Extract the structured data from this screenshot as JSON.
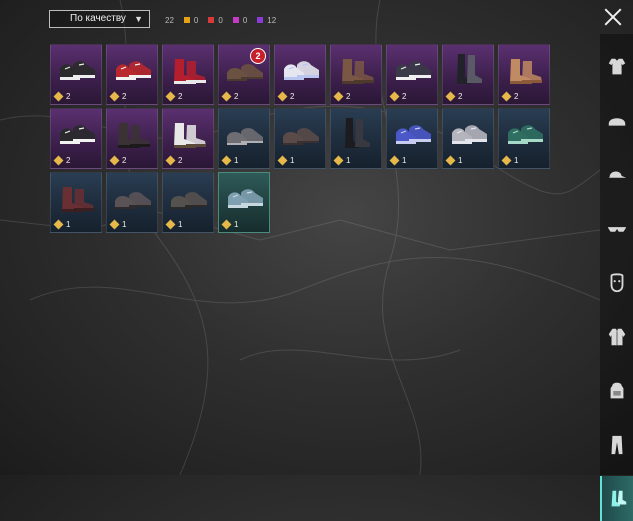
{
  "sort": {
    "label": "По качеству"
  },
  "summary": {
    "total": "22",
    "gold": {
      "count": "0",
      "color": "#e3a21a"
    },
    "red": {
      "count": "0",
      "color": "#d73a3a"
    },
    "pink": {
      "count": "0",
      "color": "#c43cc4"
    },
    "purple": {
      "count": "12",
      "color": "#8a3bd8"
    }
  },
  "categories": [
    {
      "name": "top-icon"
    },
    {
      "name": "helmet-icon"
    },
    {
      "name": "hat-icon"
    },
    {
      "name": "glasses-icon"
    },
    {
      "name": "mask-icon"
    },
    {
      "name": "jacket-icon"
    },
    {
      "name": "backpack-icon"
    },
    {
      "name": "pants-icon"
    },
    {
      "name": "shoes-icon",
      "active": true
    }
  ],
  "items": [
    {
      "count": "2",
      "rarity": "purple",
      "color": "#2b2b2b",
      "accent": "#eeeeee",
      "type": "sneaker"
    },
    {
      "count": "2",
      "rarity": "purple",
      "color": "#b8282c",
      "accent": "#f2f2f2",
      "type": "sneaker"
    },
    {
      "count": "2",
      "rarity": "purple",
      "color": "#b51f2d",
      "accent": "#e8e8e8",
      "type": "boot"
    },
    {
      "count": "2",
      "rarity": "purple",
      "color": "#6b5142",
      "accent": "#4a3a30",
      "type": "shoe",
      "badge": "2"
    },
    {
      "count": "2",
      "rarity": "purple",
      "color": "#e6e6f0",
      "accent": "#b9c6f0",
      "type": "sneaker"
    },
    {
      "count": "2",
      "rarity": "purple",
      "color": "#7a5744",
      "accent": "#4e3a2d",
      "type": "boot"
    },
    {
      "count": "2",
      "rarity": "purple",
      "color": "#3a3a48",
      "accent": "#f0f0f0",
      "type": "sneaker"
    },
    {
      "count": "2",
      "rarity": "purple",
      "color": "#22222a",
      "accent": "#5a5a66",
      "type": "tall"
    },
    {
      "count": "2",
      "rarity": "purple",
      "color": "#c08a63",
      "accent": "#8a5a3a",
      "type": "boot"
    },
    {
      "count": "2",
      "rarity": "purple",
      "color": "#2a2a2e",
      "accent": "#f2f2f2",
      "type": "sneaker"
    },
    {
      "count": "2",
      "rarity": "purple",
      "color": "#3b3236",
      "accent": "#1e1a1c",
      "type": "boot"
    },
    {
      "count": "2",
      "rarity": "purple",
      "color": "#e8e8e8",
      "accent": "#5a4a3a",
      "type": "boot"
    },
    {
      "count": "1",
      "rarity": "blue",
      "color": "#6e6e72",
      "accent": "#b0b0b4",
      "type": "shoe"
    },
    {
      "count": "1",
      "rarity": "blue",
      "color": "#5a4a48",
      "accent": "#3a3030",
      "type": "shoe"
    },
    {
      "count": "1",
      "rarity": "blue",
      "color": "#1c1c20",
      "accent": "#383840",
      "type": "tall"
    },
    {
      "count": "1",
      "rarity": "blue",
      "color": "#4a58c8",
      "accent": "#c8ccf0",
      "type": "sneaker"
    },
    {
      "count": "1",
      "rarity": "blue",
      "color": "#b4b4bc",
      "accent": "#e4e4ec",
      "type": "sneaker"
    },
    {
      "count": "1",
      "rarity": "blue",
      "color": "#2f6f62",
      "accent": "#a8d8c8",
      "type": "sneaker"
    },
    {
      "count": "1",
      "rarity": "blue",
      "color": "#6a2f32",
      "accent": "#3a1e20",
      "type": "boot"
    },
    {
      "count": "1",
      "rarity": "blue",
      "color": "#5a5356",
      "accent": "#2e2a2c",
      "type": "shoe"
    },
    {
      "count": "1",
      "rarity": "blue",
      "color": "#55514e",
      "accent": "#2c2a28",
      "type": "shoe"
    },
    {
      "count": "1",
      "rarity": "green",
      "color": "#7fa0b0",
      "accent": "#c8d8e0",
      "type": "sneaker"
    }
  ]
}
